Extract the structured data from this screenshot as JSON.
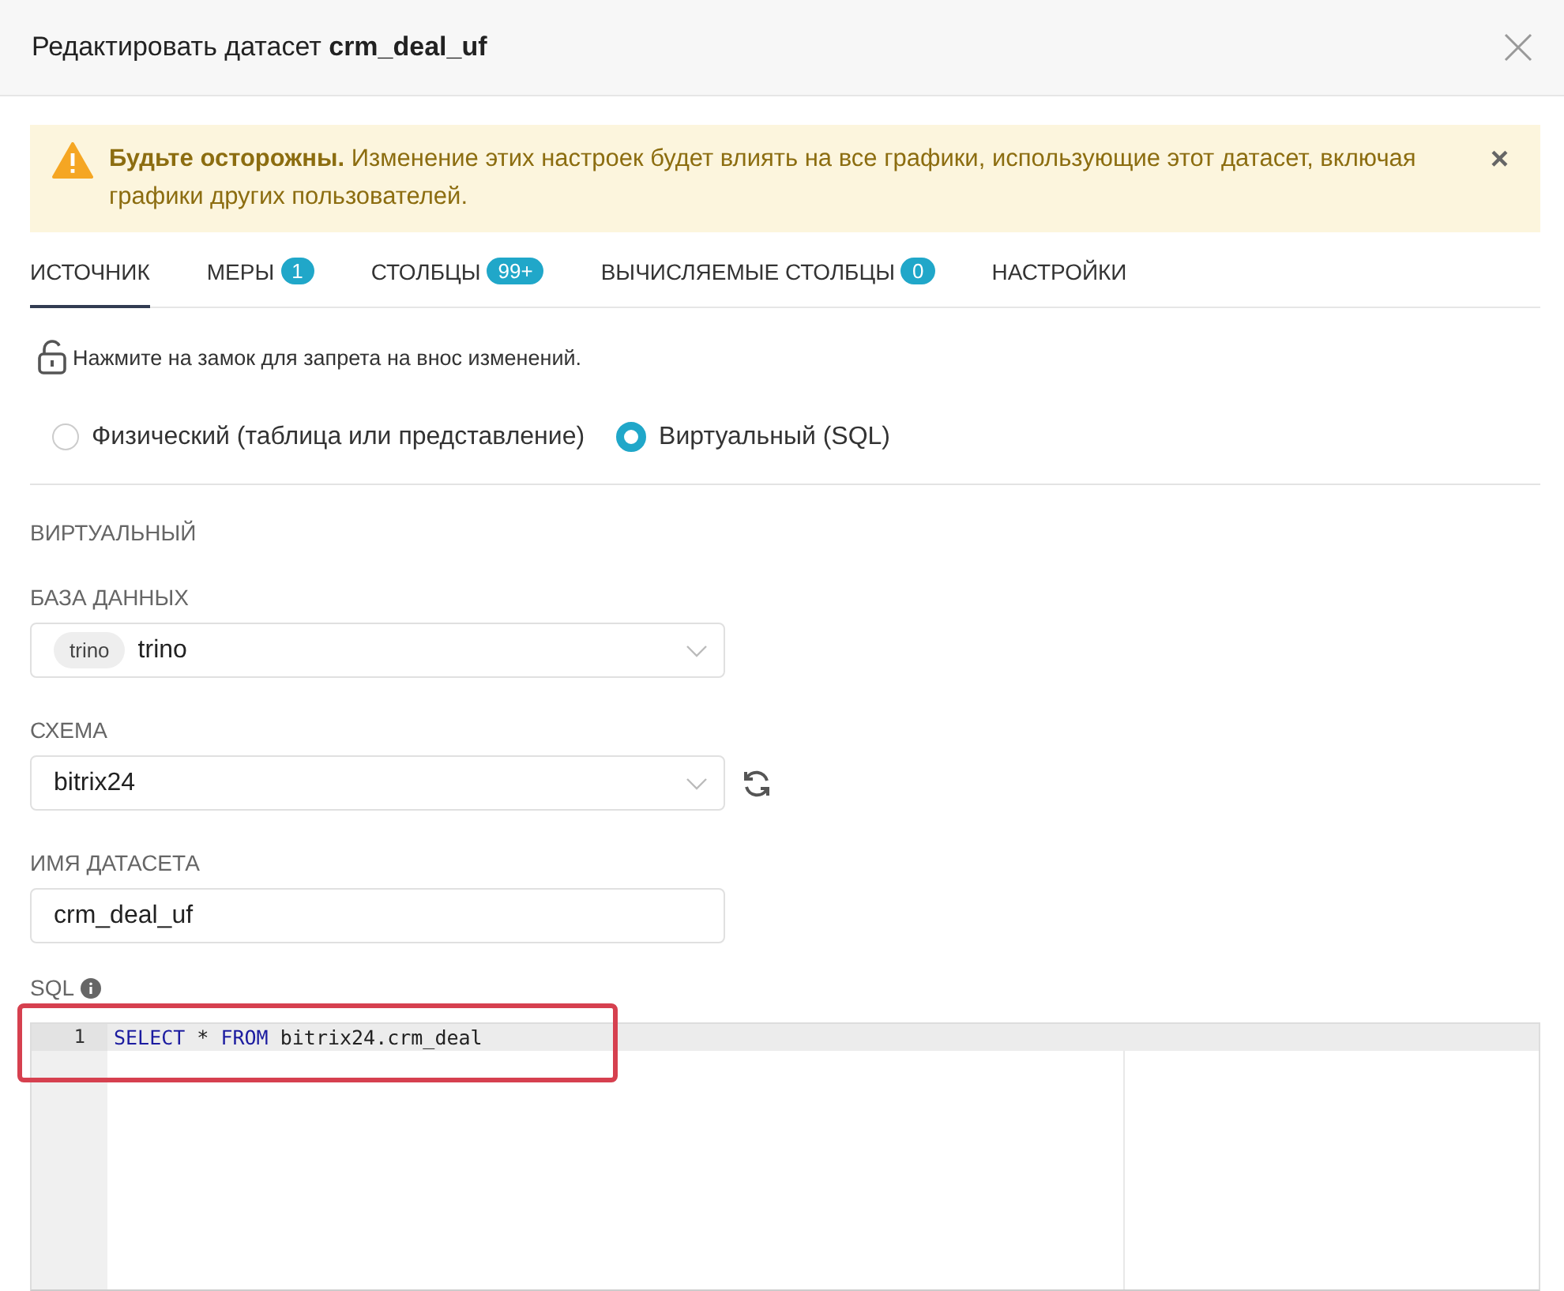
{
  "modal": {
    "title_prefix": "Редактировать датасет ",
    "title_name": "crm_deal_uf"
  },
  "alert": {
    "text": "**Будьте осторожны.** Изменение этих настроек будет влиять на все графики, использующие этот датасет, включая графики других пользователей.",
    "close": "×"
  },
  "tabs": [
    {
      "label": "ИСТОЧНИК",
      "selected": true
    },
    {
      "label": "МЕРЫ",
      "badge": "1",
      "selected": false
    },
    {
      "label": "СТОЛБЦЫ",
      "badge": "99+",
      "selected": false
    },
    {
      "label": "ВЫЧИСЛЯЕМЫЕ СТОЛБЦЫ",
      "badge": "0",
      "selected": false
    },
    {
      "label": "НАСТРОЙКИ",
      "selected": false
    }
  ],
  "lock": {
    "text": "Нажмите на замок для запрета на внос изменений.",
    "locked": false
  },
  "source_types": [
    {
      "label": "Физический (таблица или представление)",
      "selected": false
    },
    {
      "label": "Виртуальный (SQL)",
      "selected": true
    }
  ],
  "section_title": "ВИРТУАЛЬНЫЙ",
  "fields": [
    {
      "kind": "select",
      "label": "БАЗА ДАННЫХ",
      "tag": "trino",
      "value": "trino"
    },
    {
      "kind": "select",
      "label": "СХЕМА",
      "value": "bitrix24",
      "refresh": true
    },
    {
      "kind": "input",
      "label": "ИМЯ ДАТАСЕТА",
      "value": "crm_deal_uf"
    }
  ],
  "sql": {
    "label": "SQL",
    "lines": [
      {
        "number": "1",
        "tokens": [
          {
            "kind": "keyword",
            "text": "SELECT"
          },
          {
            "kind": "plain",
            "text": " * "
          },
          {
            "kind": "keyword",
            "text": "FROM"
          },
          {
            "kind": "plain",
            "text": " bitrix24.crm_deal"
          }
        ]
      }
    ]
  }
}
